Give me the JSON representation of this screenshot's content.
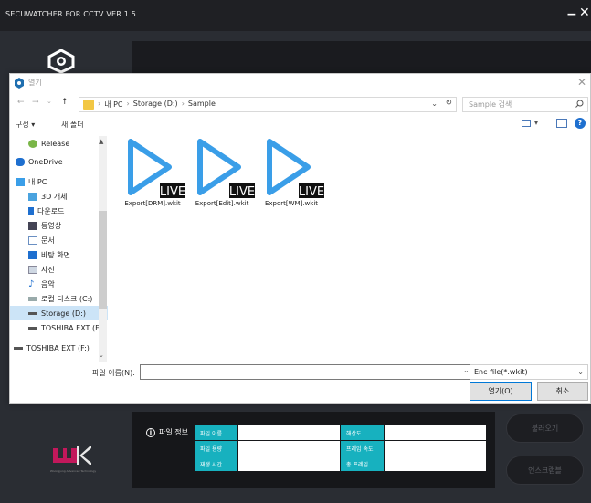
{
  "app": {
    "title": "SECUWATCHER FOR CCTV VER 1.5",
    "minimize": "−",
    "close": "✕",
    "logo_icon": "secuwatcher-logo-icon",
    "brand_tagline": "Woongjung Advanced Technology"
  },
  "dialog": {
    "title": "열기",
    "close": "✕",
    "nav": {
      "back": "←",
      "forward": "→",
      "recent": "⌄",
      "up": "↑"
    },
    "breadcrumbs": [
      "내 PC",
      "Storage (D:)",
      "Sample"
    ],
    "address_dropdown": "⌄",
    "refresh": "↻",
    "search_placeholder": "Sample 검색",
    "toolbar": {
      "organize": "구성 ▾",
      "new_folder": "새 폴더",
      "view_dropdown": "▾",
      "help": "?"
    },
    "nav_pane": {
      "items": [
        {
          "label": "Release",
          "icon": "release-icon"
        },
        {
          "label": "OneDrive",
          "icon": "onedrive-icon"
        },
        {
          "label": "내 PC",
          "icon": "pc-icon"
        },
        {
          "label": "3D 개체",
          "icon": "3d-objects-icon"
        },
        {
          "label": "다운로드",
          "icon": "downloads-icon"
        },
        {
          "label": "동영상",
          "icon": "videos-icon"
        },
        {
          "label": "문서",
          "icon": "documents-icon"
        },
        {
          "label": "바탕 화면",
          "icon": "desktop-icon"
        },
        {
          "label": "사진",
          "icon": "pictures-icon"
        },
        {
          "label": "음악",
          "icon": "music-icon"
        },
        {
          "label": "로컬 디스크 (C:)",
          "icon": "local-disk-icon"
        },
        {
          "label": "Storage (D:)",
          "icon": "drive-icon"
        },
        {
          "label": "TOSHIBA EXT (F",
          "icon": "drive-icon"
        },
        {
          "label": "TOSHIBA EXT (F:)",
          "icon": "drive-icon"
        }
      ],
      "selected_index": 11,
      "scroll_up": "▲",
      "scroll_down": "⌄"
    },
    "files": [
      {
        "name": "Export[DRM].wkit",
        "badge": "LIVE"
      },
      {
        "name": "Export[Edit].wkit",
        "badge": "LIVE"
      },
      {
        "name": "Export[WM].wkit",
        "badge": "LIVE"
      }
    ],
    "filename_label": "파일 이름(N):",
    "filename_value": "",
    "filename_dropdown": "⌄",
    "filetype": "Enc file(*.wkit)",
    "filetype_dropdown": "⌄",
    "open_button": "열기(O)",
    "cancel_button": "취소"
  },
  "info_panel": {
    "label": "파일 정보",
    "info_icon": "i",
    "rows": [
      {
        "left_key": "파일 이름",
        "left_value": "",
        "right_key": "해상도",
        "right_value": ""
      },
      {
        "left_key": "파일 용량",
        "left_value": "",
        "right_key": "프레임 속도",
        "right_value": ""
      },
      {
        "left_key": "재생 시간",
        "left_value": "",
        "right_key": "총 프레임",
        "right_value": ""
      }
    ]
  },
  "side_buttons": {
    "load": "불러오기",
    "unscramble": "언스크램블"
  },
  "colors": {
    "accent_teal": "#17b1bf",
    "play_blue": "#3a9ee8",
    "brand_magenta": "#c2185b",
    "app_bg": "#2a2d33"
  }
}
